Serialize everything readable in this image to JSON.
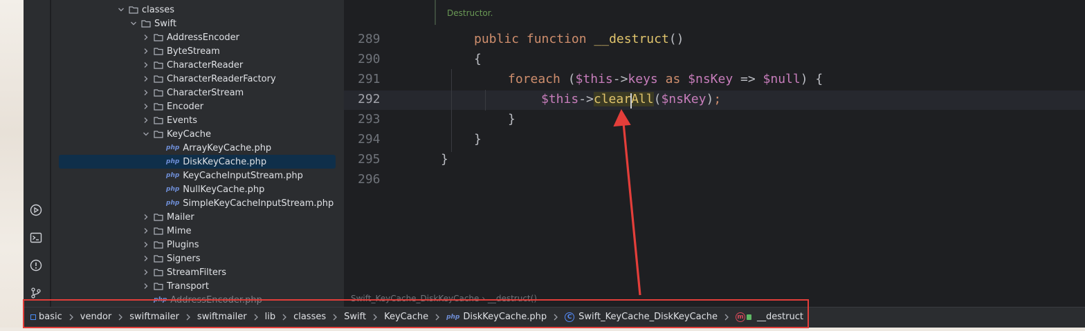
{
  "project_tree": {
    "rows": [
      {
        "label": "classes",
        "type": "folder",
        "expanded": true
      },
      {
        "label": "Swift",
        "type": "folder",
        "expanded": true
      },
      {
        "label": "AddressEncoder",
        "type": "folder",
        "expanded": false
      },
      {
        "label": "ByteStream",
        "type": "folder",
        "expanded": false
      },
      {
        "label": "CharacterReader",
        "type": "folder",
        "expanded": false
      },
      {
        "label": "CharacterReaderFactory",
        "type": "folder",
        "expanded": false
      },
      {
        "label": "CharacterStream",
        "type": "folder",
        "expanded": false
      },
      {
        "label": "Encoder",
        "type": "folder",
        "expanded": false
      },
      {
        "label": "Events",
        "type": "folder",
        "expanded": false
      },
      {
        "label": "KeyCache",
        "type": "folder",
        "expanded": true
      },
      {
        "label": "ArrayKeyCache.php",
        "type": "file"
      },
      {
        "label": "DiskKeyCache.php",
        "type": "file",
        "selected": true
      },
      {
        "label": "KeyCacheInputStream.php",
        "type": "file"
      },
      {
        "label": "NullKeyCache.php",
        "type": "file"
      },
      {
        "label": "SimpleKeyCacheInputStream.php",
        "type": "file"
      },
      {
        "label": "Mailer",
        "type": "folder",
        "expanded": false
      },
      {
        "label": "Mime",
        "type": "folder",
        "expanded": false
      },
      {
        "label": "Plugins",
        "type": "folder",
        "expanded": false
      },
      {
        "label": "Signers",
        "type": "folder",
        "expanded": false
      },
      {
        "label": "StreamFilters",
        "type": "folder",
        "expanded": false
      },
      {
        "label": "Transport",
        "type": "folder",
        "expanded": false
      },
      {
        "label": "AddressEncoder.php",
        "type": "file",
        "partial": true
      }
    ],
    "file_badge": "php"
  },
  "editor": {
    "doc_hint": "Destructor.",
    "line_numbers": [
      "289",
      "290",
      "291",
      "292",
      "293",
      "294",
      "295",
      "296"
    ],
    "code": {
      "l289_kw1": "public",
      "l289_kw2": "function",
      "l289_name": "__destruct",
      "l289_parens": "()",
      "l290": "{",
      "l291_kw": "foreach",
      "l291_open": " (",
      "l291_this": "$this",
      "l291_arrow": "->",
      "l291_prop": "keys",
      "l291_as": " as ",
      "l291_nskey": "$nsKey",
      "l291_fat": " => ",
      "l291_null": "$null",
      "l291_close": ") {",
      "l292_this": "$this",
      "l292_arrow": "->",
      "l292_call_a": "clea",
      "l292_call_b": "rAll",
      "l292_open": "(",
      "l292_arg": "$nsKey",
      "l292_close": ")",
      "l292_semi": ";",
      "l293": "}",
      "l294": "}",
      "l295": "}"
    },
    "inner_breadcrumb": "Swift_KeyCache_DiskKeyCache  ›  __destruct()"
  },
  "navigation_bar": {
    "items": [
      "basic",
      "vendor",
      "swiftmailer",
      "swiftmailer",
      "lib",
      "classes",
      "Swift",
      "KeyCache"
    ],
    "file_badge": "php",
    "file": "DiskKeyCache.php",
    "class_badge": "C",
    "class": "Swift_KeyCache_DiskKeyCache",
    "method_badge": "m",
    "method": "__destruct"
  },
  "colors": {
    "annotation_red": "#e33e3a",
    "selection": "#0f2f4a",
    "keyword": "#cf8e6d",
    "variable": "#c77dbb",
    "function_name": "#56a8f5"
  },
  "icons": {
    "toolstrip": [
      "run-services-icon",
      "terminal-icon",
      "problems-icon",
      "git-icon"
    ]
  }
}
